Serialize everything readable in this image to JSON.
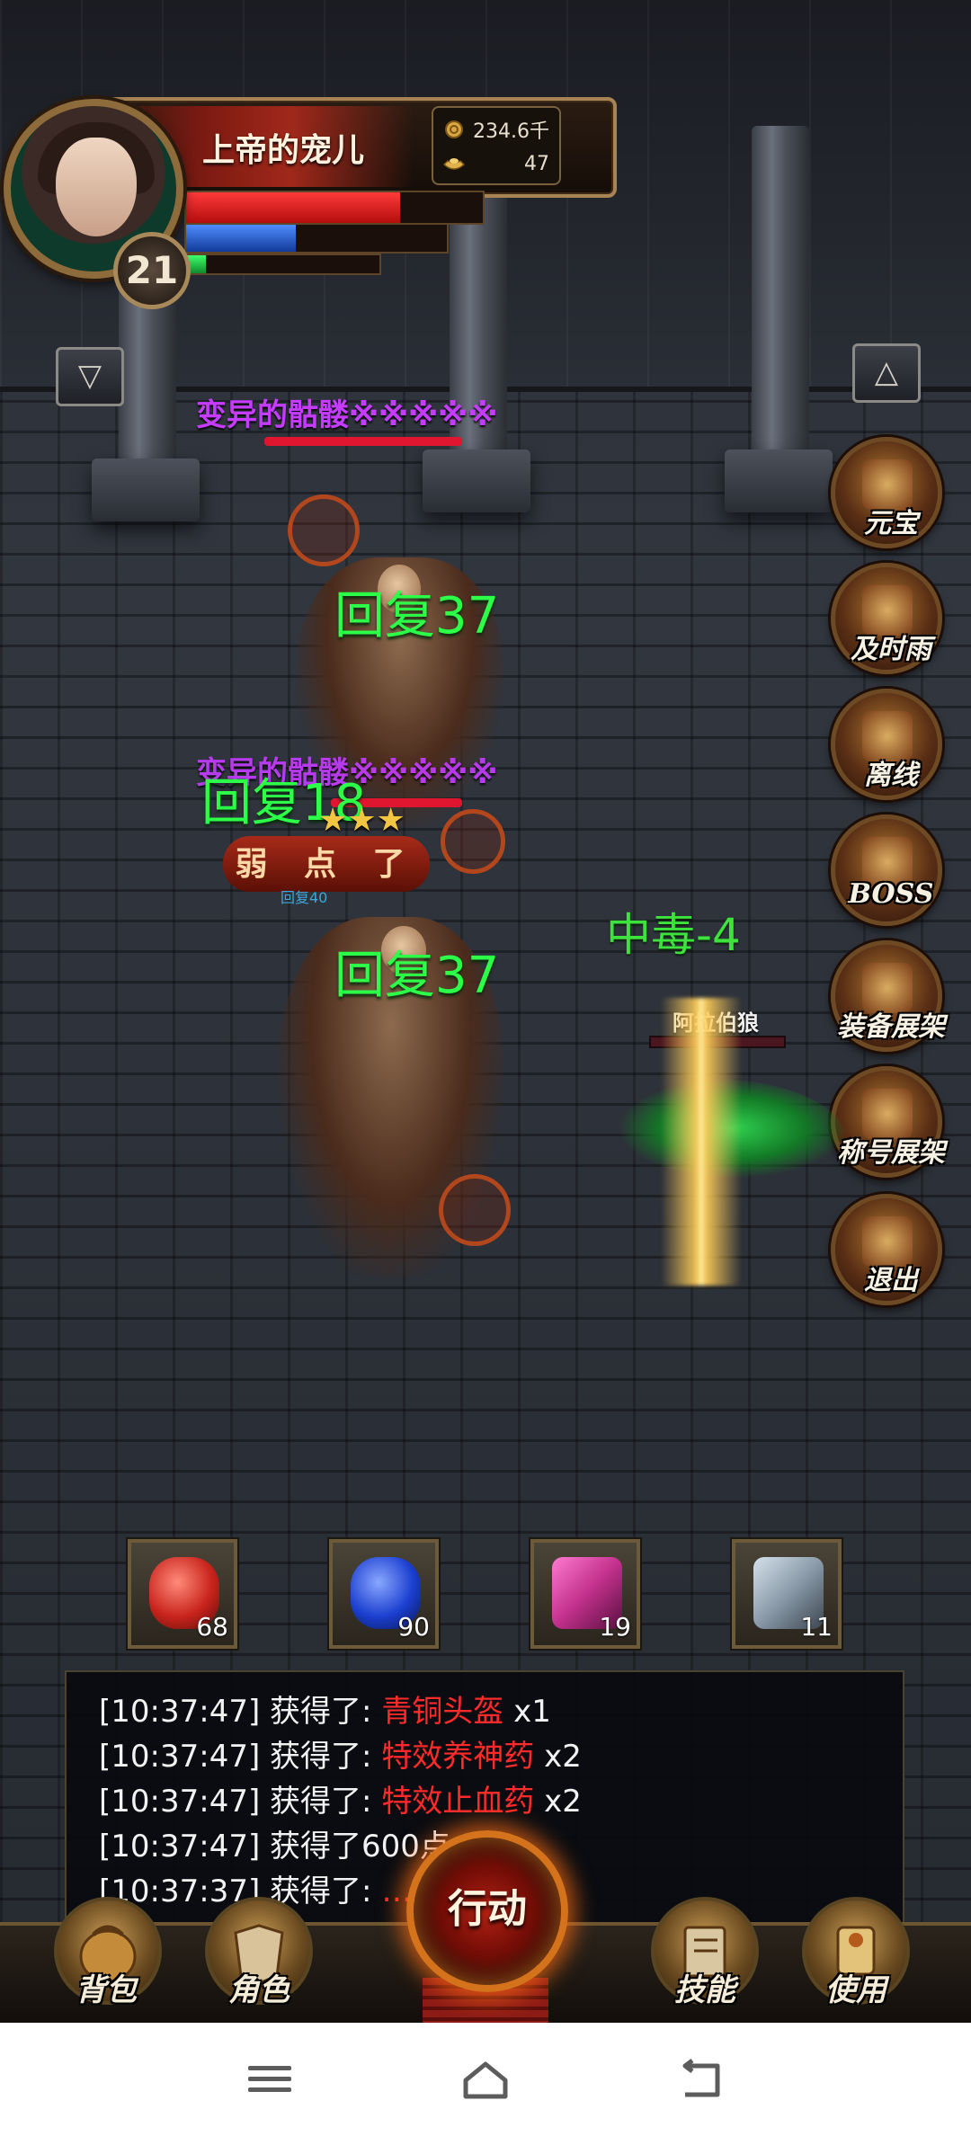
{
  "player": {
    "name": "上帝的宠儿",
    "level": "21",
    "gold": "234.6千",
    "ingots": "47",
    "hp_fraction": 0.72,
    "mp_fraction": 0.42,
    "xp_fraction": 0.1
  },
  "buttons": {
    "collapse_left": "▽",
    "expand_right": "△"
  },
  "side_menu": [
    {
      "label": "元宝",
      "icon": "treasure-chest-icon"
    },
    {
      "label": "及时雨",
      "icon": "rain-chest-icon"
    },
    {
      "label": "离线",
      "icon": "offline-mask-icon"
    },
    {
      "label": "BOSS",
      "icon": "boss-skull-icon"
    },
    {
      "label": "装备展架",
      "icon": "equipment-rack-icon"
    },
    {
      "label": "称号展架",
      "icon": "title-scroll-icon"
    },
    {
      "label": "退出",
      "icon": "exit-gear-icon"
    }
  ],
  "combat": {
    "mob1_name": "变异的骷髅※※※※※",
    "mob2_name": "变异的骷髅※※※※※",
    "heal_a": "回复37",
    "heal_b": "回复18",
    "heal_c": "回复37",
    "small_heal": "回复40",
    "weak_status": "弱 点 了",
    "stars": "★★★",
    "poison": "中毒-4",
    "wolf_name": "阿拉伯狼"
  },
  "quick_slots": [
    {
      "qty": "68",
      "icon": "red-potion-icon",
      "color": "#c9241c"
    },
    {
      "qty": "90",
      "icon": "blue-potion-icon",
      "color": "#1b3fd0"
    },
    {
      "qty": "19",
      "icon": "scroll-bundle-icon",
      "color": "#c2318d"
    },
    {
      "qty": "11",
      "icon": "scroll-grey-icon",
      "color": "#8a9aa8"
    }
  ],
  "log": [
    {
      "prefix": "[10:37:47] 获得了: ",
      "item": "青铜头盔",
      "suffix": " x1"
    },
    {
      "prefix": "[10:37:47] 获得了: ",
      "item": "特效养神药",
      "suffix": " x2"
    },
    {
      "prefix": "[10:37:47] 获得了: ",
      "item": "特效止血药",
      "suffix": " x2"
    },
    {
      "prefix": "[10:37:47] 获得了600点",
      "item": "",
      "suffix": ""
    },
    {
      "prefix": "[10:37:37] 获得了: ",
      "item": "…",
      "suffix": ""
    }
  ],
  "action_bar": {
    "bag": "背包",
    "character": "角色",
    "main_action": "行动",
    "skills": "技能",
    "use": "使用"
  },
  "colors": {
    "accent_gold": "#a88454",
    "hp_red": "#e01530",
    "mob_name_purple": "#c53cff",
    "heal_green": "#2cff47",
    "loot_red": "#ff2a2a"
  },
  "system_nav": {
    "menu_icon": "menu-icon",
    "home_icon": "home-icon",
    "back_icon": "back-icon"
  }
}
